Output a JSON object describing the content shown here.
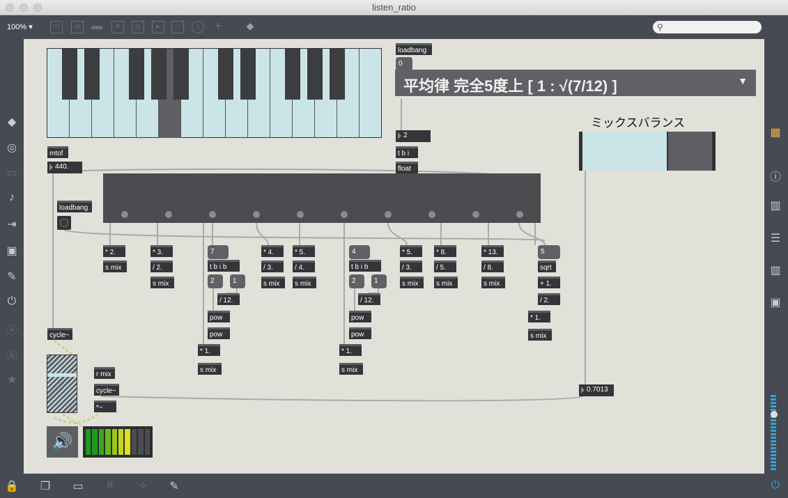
{
  "window": {
    "title": "listen_ratio"
  },
  "toolbar": {
    "zoom": "100% ▾",
    "search_placeholder": ""
  },
  "menu": {
    "selected": "平均律 完全5度上 [ 1 : √(7/12) ]"
  },
  "mix": {
    "label": "ミックスバランス",
    "value": 0.66
  },
  "objects": {
    "mtof": "mtof",
    "freq": "440.",
    "loadbang1": "loadbang",
    "loadbang2": "loadbang",
    "msg0": "0",
    "num2": "2",
    "tbi": "t b i",
    "float": "float",
    "m2": "* 2.",
    "s1": "s mix",
    "m3": "* 3.",
    "d2": "/ 2.",
    "s2": "s mix",
    "msg7": "7",
    "tbib1": "t b i b",
    "msg2a": "2",
    "msg1a": "1",
    "d12a": "/ 12.",
    "pow1": "pow",
    "pow2": "pow",
    "m1a": "* 1.",
    "s3": "s mix",
    "m4": "* 4.",
    "d3": "/ 3.",
    "s4": "s mix",
    "m5": "* 5.",
    "d4": "/ 4.",
    "s5": "s mix",
    "msg4": "4",
    "tbib2": "t b i b",
    "msg2b": "2",
    "msg1b": "1",
    "d12b": "/ 12.",
    "pow3": "pow",
    "pow4": "pow",
    "m1b": "* 1.",
    "s6": "s mix",
    "m5b": "* 5.",
    "d3b": "/ 3.",
    "s7": "s mix",
    "m8": "* 8.",
    "d5": "/ 5.",
    "s8": "s mix",
    "m13": "* 13.",
    "d8": "/ 8.",
    "s9": "s mix",
    "msg5": "5",
    "sqrt": "sqrt",
    "p1": "+ 1.",
    "d2b": "/ 2.",
    "m1c": "* 1.",
    "s10": "s mix",
    "cycle1": "cycle~",
    "rmix": "r mix",
    "cycle2": "cycle~",
    "mult": "*~",
    "mixval": "0.7013"
  },
  "keyboard": {
    "highlighted_note": "A"
  }
}
